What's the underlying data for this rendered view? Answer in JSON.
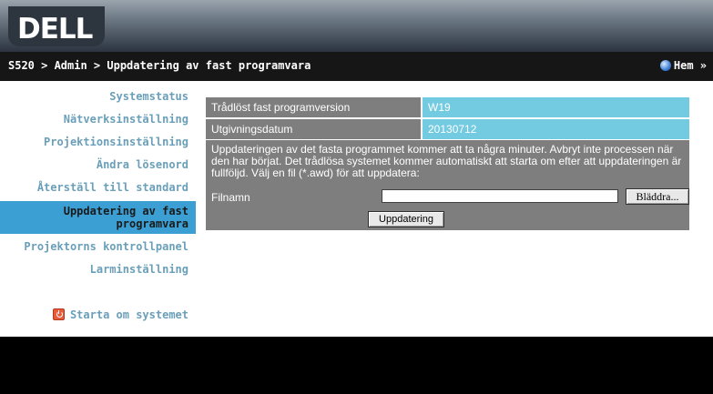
{
  "header": {
    "logo_text": "DELL",
    "breadcrumb": "S520 > Admin > Uppdatering av fast programvara",
    "home_label": "Hem »"
  },
  "sidebar": {
    "items": [
      {
        "label": "Systemstatus"
      },
      {
        "label": "Nätverksinställning"
      },
      {
        "label": "Projektionsinställning"
      },
      {
        "label": "Ändra lösenord"
      },
      {
        "label": "Återställ till standard"
      },
      {
        "label_line1": "Uppdatering av fast",
        "label_line2": "programvara",
        "active": true
      },
      {
        "label": "Projektorns kontrollpanel"
      },
      {
        "label": "Larminställning"
      }
    ],
    "restart_label": "Starta om systemet"
  },
  "content": {
    "version_label": "Trådlöst fast programversion",
    "version_value": "W19",
    "date_label": "Utgivningsdatum",
    "date_value": "20130712",
    "description": "Uppdateringen av det fasta programmet kommer att ta några minuter. Avbryt inte processen när den har börjat. Det trådlösa systemet kommer automatiskt att starta om efter att uppdateringen är fullföljd. Välj en fil (*.awd) för att uppdatera:",
    "file_label": "Filnamn",
    "file_value": "",
    "browse_label": "Bläddra...",
    "update_label": "Uppdatering"
  },
  "colors": {
    "active_menu": "#3b9fd4",
    "menu_text": "#6a9fba",
    "label_bg": "#7e7e7e",
    "value_bg": "#73cbe1"
  }
}
